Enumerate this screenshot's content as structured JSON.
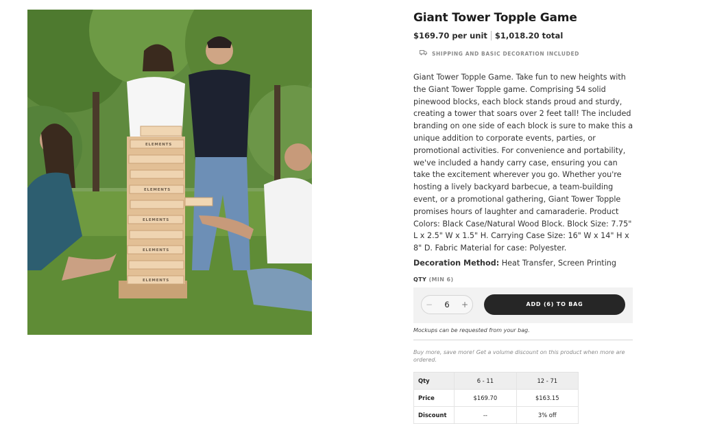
{
  "product": {
    "title": "Giant Tower Topple Game",
    "unit_price": "$169.70 per unit",
    "total_price": "$1,018.20 total",
    "shipping_note": "SHIPPING AND BASIC DECORATION INCLUDED",
    "description": "Giant Tower Topple Game. Take fun to new heights with the Giant Tower Topple game. Comprising 54 solid pinewood blocks, each block stands proud and sturdy, creating a tower that soars over 2 feet tall! The included branding on one side of each block is sure to make this a unique addition to corporate events, parties, or promotional activities. For convenience and portability, we've included a handy carry case, ensuring you can take the excitement wherever you go. Whether you're hosting a lively backyard barbecue, a team-building event, or a promotional gathering, Giant Tower Topple promises hours of laughter and camaraderie. Product Colors: Black Case/Natural Wood Block. Block Size: 7.75\" L x 2.5\" W x 1.5\" H. Carrying Case Size: 16\" W x 14\" H x 8\" D. Fabric Material for case: Polyester.",
    "decoration_label": "Decoration Method:",
    "decoration_value": "Heat Transfer, Screen Printing",
    "image_block_text": "ELEMENTS"
  },
  "purchase": {
    "qty_label": "QTY",
    "qty_min": "(MIN 6)",
    "minus": "−",
    "plus": "+",
    "quantity": "6",
    "add_button": "ADD (6) TO BAG",
    "mockup_note": "Mockups can be requested from your bag."
  },
  "volume": {
    "note": "Buy more, save more! Get a volume discount on this product when more are ordered.",
    "header": [
      "Qty",
      "6 - 11",
      "12 - 71"
    ],
    "rows": [
      [
        "Price",
        "$169.70",
        "$163.15"
      ],
      [
        "Discount",
        "--",
        "3% off"
      ]
    ]
  },
  "colors": {
    "button_bg": "#262626",
    "buybox_bg": "#f2f2f2",
    "grass": "#6f9a52",
    "wood": "#e9c9a0"
  },
  "icons": {
    "shipping": "truck-icon"
  }
}
